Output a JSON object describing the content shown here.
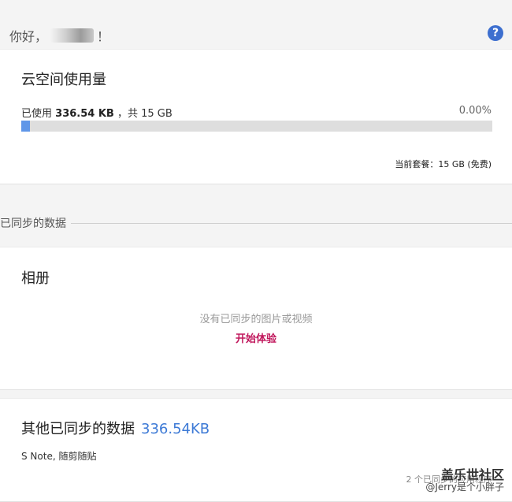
{
  "header": {
    "greeting_prefix": "你好，",
    "greeting_suffix": "！",
    "help_icon": "question-circle-icon",
    "help_label": "?"
  },
  "storage": {
    "title": "云空间使用量",
    "used_label": "已使用",
    "used_value": "336.54 KB",
    "total_text": "，共 15 GB",
    "percent": "0.00%",
    "progress_fraction": 0.0,
    "plan_text": "当前套餐：15 GB (免费)",
    "bar_color": "#5f96e8"
  },
  "synced_section": {
    "title": "已同步的数据"
  },
  "album": {
    "title": "相册",
    "empty_text": "没有已同步的图片或视频",
    "start_label": "开始体验",
    "start_color": "#c0165b"
  },
  "other": {
    "title": "其他已同步的数据",
    "size": "336.54KB",
    "apps": "S Note, 随剪随贴",
    "apps_count": "2 个已同步的应用程序",
    "size_color": "#3d7ad6"
  },
  "watermark": {
    "title": "盖乐世社区",
    "subtitle": "@Jerry是个小胖子"
  }
}
